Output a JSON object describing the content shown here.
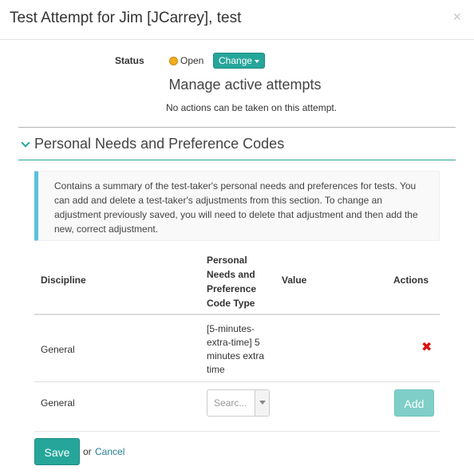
{
  "modal": {
    "title": "Test Attempt for Jim [JCarrey], test",
    "close_icon": "×"
  },
  "status": {
    "label": "Status",
    "value": "Open",
    "dot_color": "#f0ad1c",
    "change_label": "Change"
  },
  "manage": {
    "title": "Manage active attempts",
    "subtitle": "No actions can be taken on this attempt."
  },
  "section": {
    "title": "Personal Needs and Preference Codes",
    "info": "Contains a summary of the test-taker's personal needs and preferences for tests. You can add and delete a test-taker's adjustments from this section. To change an adjustment previously saved, you will need to delete that adjustment and then add the new, correct adjustment."
  },
  "table": {
    "headers": {
      "discipline": "Discipline",
      "code_type": "Personal Needs and Preference Code Type",
      "value": "Value",
      "actions": "Actions"
    },
    "rows": [
      {
        "discipline": "General",
        "code_type": "[5-minutes-extra-time] 5 minutes extra time",
        "value": "",
        "delete_icon": "✖"
      }
    ],
    "new_row": {
      "discipline": "General",
      "select_placeholder": "Searc...",
      "add_label": "Add"
    }
  },
  "footer": {
    "save_label": "Save",
    "or_text": "or",
    "cancel_label": "Cancel"
  },
  "colors": {
    "accent": "#26a69a",
    "info_border": "#5bc0de",
    "delete": "#d9130f"
  }
}
